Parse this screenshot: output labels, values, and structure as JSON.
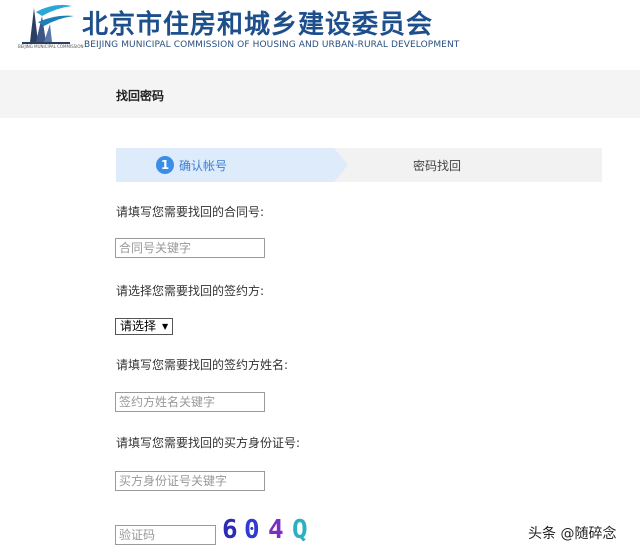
{
  "header": {
    "logo_caption": "BEIJING MUNICIPAL COMMISSION",
    "title_cn": "北京市住房和城乡建设委员会",
    "title_en": "BEIJING MUNICIPAL COMMISSION OF HOUSING AND URBAN-RURAL DEVELOPMENT"
  },
  "page": {
    "title": "找回密码"
  },
  "steps": [
    {
      "num": "1",
      "label": "确认帐号",
      "active": true
    },
    {
      "label": "密码找回",
      "active": false
    }
  ],
  "form": {
    "contract": {
      "label": "请填写您需要找回的合同号:",
      "placeholder": "合同号关键字"
    },
    "party": {
      "label": "请选择您需要找回的签约方:",
      "selected": "请选择"
    },
    "party_name": {
      "label": "请填写您需要找回的签约方姓名:",
      "placeholder": "签约方姓名关键字"
    },
    "buyer_id": {
      "label": "请填写您需要找回的买方身份证号:",
      "placeholder": "买方身份证号关键字"
    },
    "captcha": {
      "placeholder": "验证码",
      "code": "604Q"
    }
  },
  "watermark": "头条 @随碎念",
  "colors": {
    "brand_blue": "#1d4f8c",
    "step_active_bg": "#ddebfb",
    "step_num_bg": "#3b8ee8"
  }
}
